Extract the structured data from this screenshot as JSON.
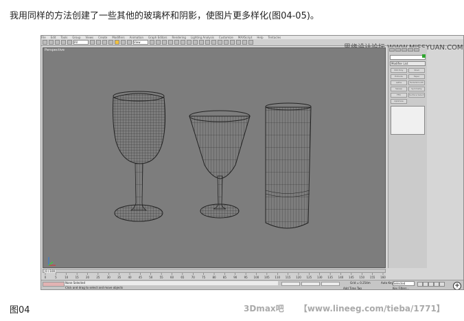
{
  "caption": "我用同样的方法创建了一些其他的玻璃杯和阴影，使图片更多样化(图04-05)。",
  "figure_label": "图04",
  "credit": {
    "tag": "3Dmax吧",
    "url": "【www.lineeg.com/tieba/1771】"
  },
  "watermark": "思缘设计论坛 WWW.MISSYUAN.COM",
  "app": {
    "menu": [
      "File",
      "Edit",
      "Tools",
      "Group",
      "Views",
      "Create",
      "Modifiers",
      "Animation",
      "Graph Editors",
      "Rendering",
      "Lighting Analysis",
      "Customize",
      "MAXScript",
      "Help",
      "Tentacles"
    ],
    "selection_filter": "All",
    "view_dropdown": "View",
    "viewport_label": "Perspective",
    "command_panel": {
      "modifier_list": "Modifier List",
      "buttons": [
        "Edit Poly",
        "Shell",
        "Extrude",
        "Taper",
        "Lathe",
        "TurboSmooth",
        "Sweep",
        "Symmetry",
        "FFD",
        "Surface Select",
        "Optimize"
      ]
    },
    "time_slider": "0 / 100",
    "ruler_ticks": [
      0,
      5,
      10,
      15,
      20,
      25,
      30,
      35,
      40,
      45,
      50,
      55,
      60,
      65,
      70,
      75,
      80,
      85,
      90,
      95,
      100,
      105,
      110,
      115,
      120,
      125,
      130,
      135,
      140,
      145,
      150,
      155,
      160
    ],
    "status": {
      "selection": "None Selected",
      "prompt": "Click and drag to select and move objects",
      "grid": "Grid = 0.254m",
      "add_time_tag": "Add Time Tag",
      "auto_key": "Auto Key",
      "set_key": "Set Key",
      "selected": "Selected",
      "key_filters": "Key Filters..."
    },
    "accent_color": "#2ea62e"
  }
}
